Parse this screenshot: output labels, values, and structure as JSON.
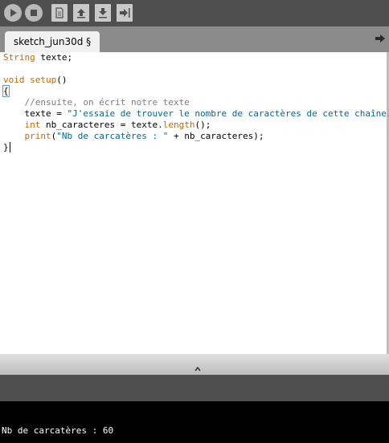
{
  "toolbar": {
    "buttons": [
      {
        "name": "run-button",
        "icon": "play-icon"
      },
      {
        "name": "stop-button",
        "icon": "stop-icon"
      },
      {
        "name": "new-button",
        "icon": "new-file-icon"
      },
      {
        "name": "open-button",
        "icon": "open-arrow-up-icon"
      },
      {
        "name": "save-button",
        "icon": "save-arrow-down-icon"
      },
      {
        "name": "export-button",
        "icon": "export-arrow-right-icon"
      }
    ]
  },
  "tabs": {
    "active_label": "sketch_jun30d §",
    "menu_icon": "tab-menu-arrow-icon"
  },
  "editor": {
    "lines": [
      [
        {
          "t": "String",
          "c": "kw"
        },
        {
          "t": " texte;",
          "c": ""
        }
      ],
      [],
      [
        {
          "t": "void",
          "c": "kw"
        },
        {
          "t": " ",
          "c": ""
        },
        {
          "t": "setup",
          "c": "kw"
        },
        {
          "t": "()",
          "c": ""
        }
      ],
      [
        {
          "t": "{",
          "c": "brace"
        }
      ],
      [
        {
          "t": "    ",
          "c": ""
        },
        {
          "t": "//ensuite, on écrit notre texte",
          "c": "cm"
        }
      ],
      [
        {
          "t": "    texte = ",
          "c": ""
        },
        {
          "t": "\"J'essaie de trouver le nombre de caractères de cette chaîne.\"",
          "c": "st"
        },
        {
          "t": ";",
          "c": ""
        }
      ],
      [
        {
          "t": "    ",
          "c": ""
        },
        {
          "t": "int",
          "c": "kw"
        },
        {
          "t": " nb_caracteres = texte.",
          "c": ""
        },
        {
          "t": "length",
          "c": "kw"
        },
        {
          "t": "();",
          "c": ""
        }
      ],
      [
        {
          "t": "    ",
          "c": ""
        },
        {
          "t": "print",
          "c": "kw"
        },
        {
          "t": "(",
          "c": ""
        },
        {
          "t": "\"Nb de carcatères : \"",
          "c": "st"
        },
        {
          "t": " + nb_caracteres);",
          "c": ""
        }
      ],
      [
        {
          "t": "}",
          "c": "caret"
        }
      ]
    ]
  },
  "console": {
    "output": "Nb de carcatères : 60"
  },
  "colors": {
    "keyword": "#cc6600",
    "comment": "#7e7e7e",
    "string": "#006699",
    "toolbar_bg": "#4f4f4f",
    "tabbar_bg": "#8b8b8b",
    "console_bg": "#000000"
  }
}
